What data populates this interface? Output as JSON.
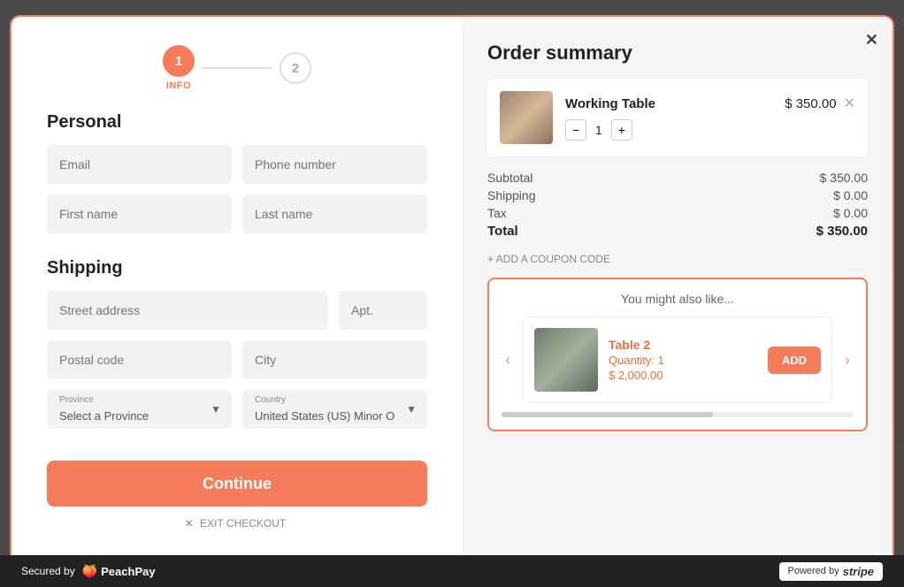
{
  "modal": {
    "close_label": "✕"
  },
  "stepper": {
    "step1_label": "1",
    "step2_label": "2",
    "step1_info": "INFO"
  },
  "personal": {
    "section_title": "Personal",
    "email_placeholder": "Email",
    "phone_placeholder": "Phone number",
    "firstname_placeholder": "First name",
    "lastname_placeholder": "Last name"
  },
  "shipping": {
    "section_title": "Shipping",
    "street_placeholder": "Street address",
    "apt_placeholder": "Apt.",
    "postal_placeholder": "Postal code",
    "city_placeholder": "City",
    "province_label": "Province",
    "province_default": "Select a Province",
    "country_label": "Country",
    "country_default": "United States (US) Minor O"
  },
  "actions": {
    "continue_label": "Continue",
    "exit_label": "EXIT CHECKOUT"
  },
  "order_summary": {
    "title": "Order summary",
    "product_name": "Working Table",
    "product_price": "$ 350.00",
    "quantity": "1",
    "subtotal_label": "Subtotal",
    "subtotal_value": "$ 350.00",
    "shipping_label": "Shipping",
    "shipping_value": "$ 0.00",
    "tax_label": "Tax",
    "tax_value": "$ 0.00",
    "total_label": "Total",
    "total_value": "$ 350.00",
    "coupon_label": "+ ADD A COUPON CODE"
  },
  "recommendations": {
    "title": "You might also like...",
    "item_name": "Table 2",
    "item_qty_label": "Quantity: 1",
    "item_price": "$ 2,000.00",
    "add_label": "ADD"
  },
  "footer": {
    "secured_label": "Secured by",
    "brand_name": "PeachPay",
    "powered_label": "Powered by",
    "stripe_label": "stripe"
  }
}
